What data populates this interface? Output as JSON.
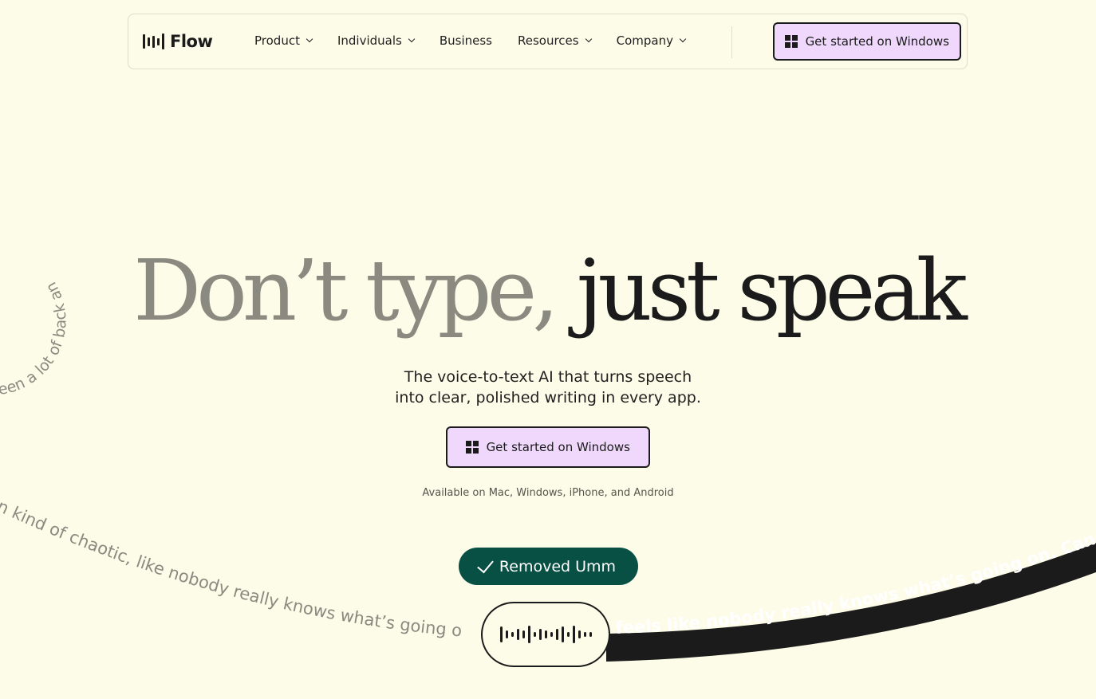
{
  "nav": {
    "logo_text": "Flow",
    "links": [
      {
        "label": "Product",
        "has_dropdown": true
      },
      {
        "label": "Individuals",
        "has_dropdown": true
      },
      {
        "label": "Business",
        "has_dropdown": false
      },
      {
        "label": "Resources",
        "has_dropdown": true
      },
      {
        "label": "Company",
        "has_dropdown": true
      }
    ],
    "cta_label": "Get started on Windows"
  },
  "hero": {
    "headline_part1": "Don’t type,",
    "headline_part2": "just speak",
    "subtitle_line1": "The voice-to-text AI that turns speech",
    "subtitle_line2": "into clear, polished writing in every app.",
    "cta_label": "Get started on Windows",
    "availability": "Available on Mac, Windows, iPhone, and Android"
  },
  "demo": {
    "badge_label": "Removed Umm",
    "raw_text": "n kind of chaotic, like nobody really knows what’s going o",
    "polished_text": "feels like nobody really knows what’s going on. Can yo",
    "circle_text": "een a lot of back an"
  },
  "icons": {
    "windows": "windows-logo-icon",
    "check": "check-icon",
    "waveform": "waveform-icon"
  },
  "colors": {
    "background": "#fdfce8",
    "cta_fill": "#efd8fb",
    "badge": "#084f44",
    "text": "#1b1b1b",
    "muted_headline": "#8a8a80"
  }
}
